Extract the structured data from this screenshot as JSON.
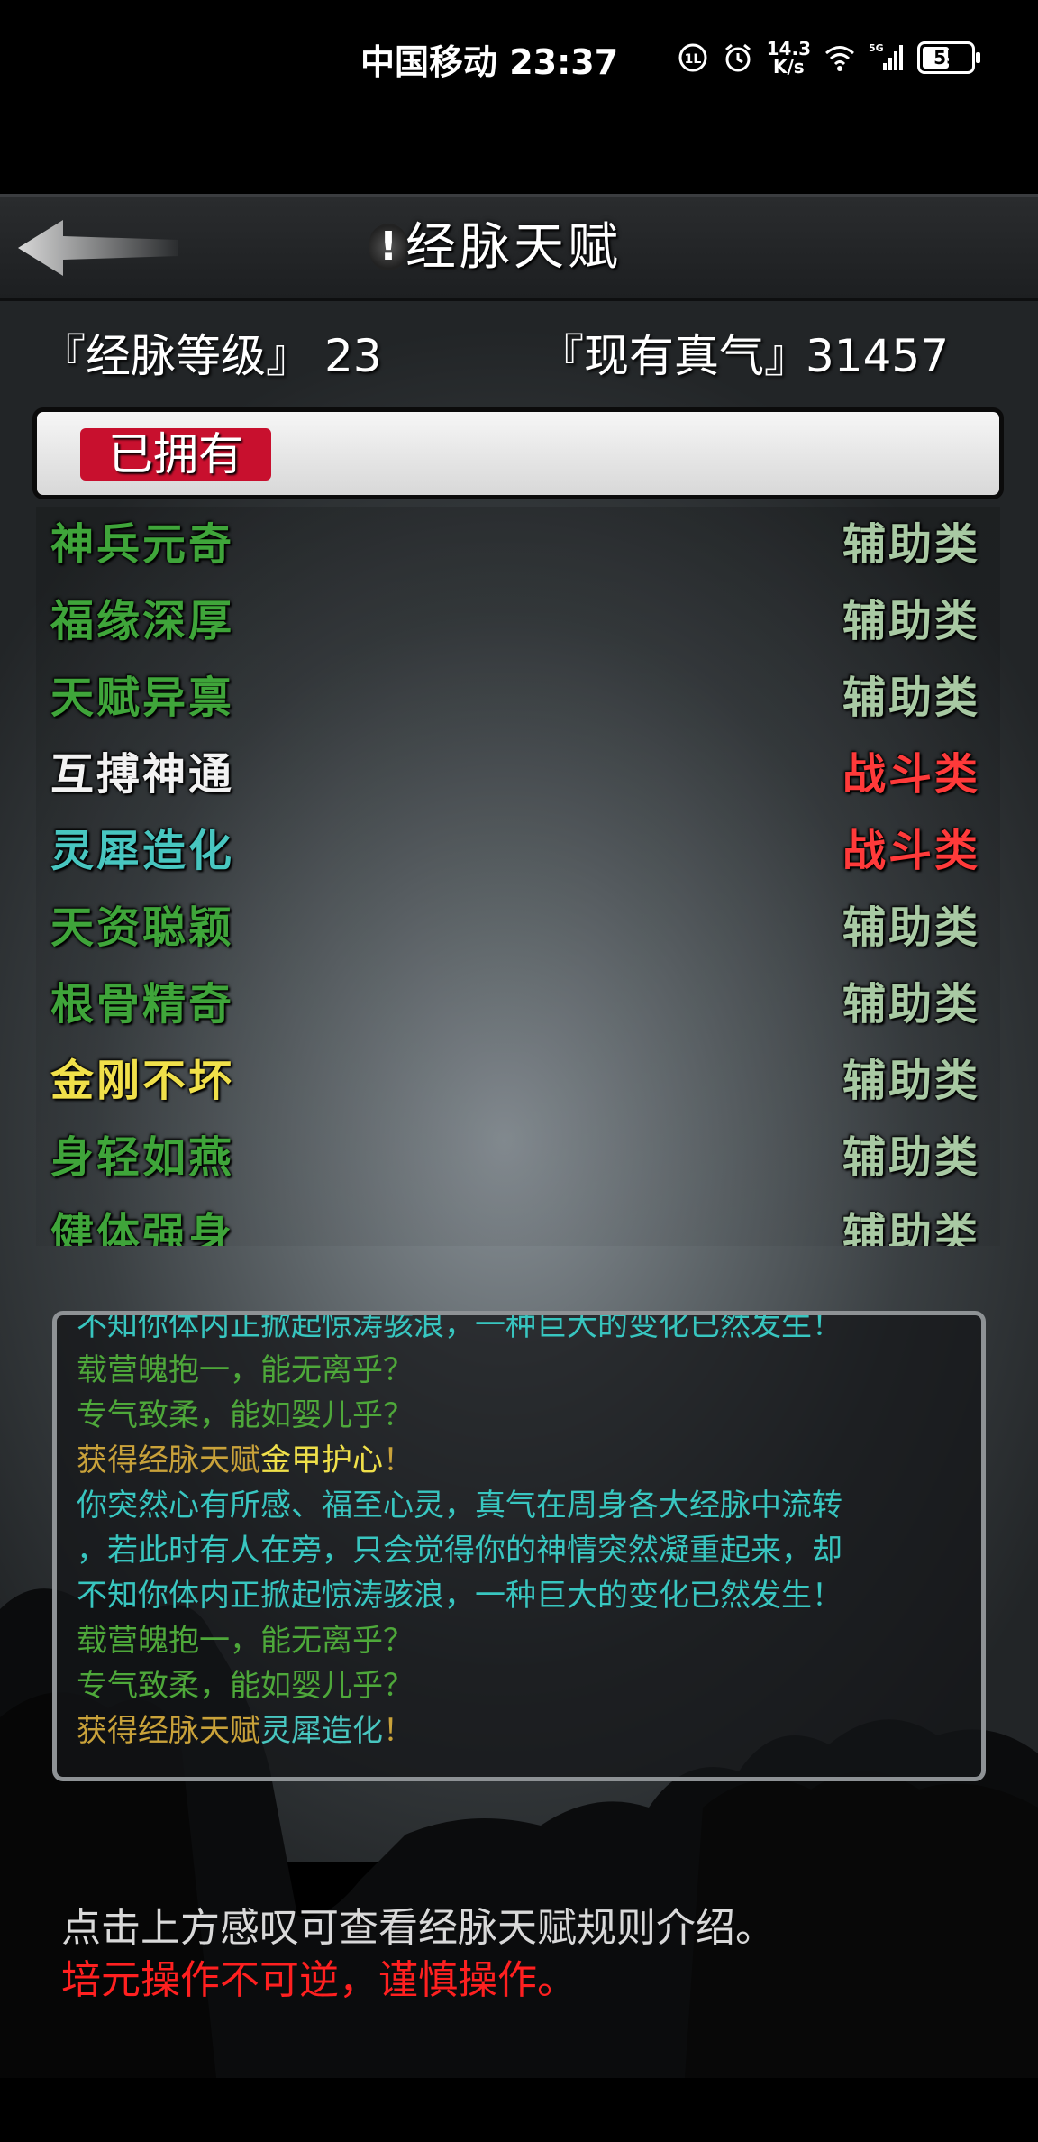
{
  "status_bar": {
    "carrier_time": "中国移动 23:37",
    "net_speed_top": "14.3",
    "net_speed_unit": "K/s",
    "net_type": "5G",
    "battery": "55"
  },
  "header": {
    "help_glyph": "!",
    "title": "经脉天赋"
  },
  "stats": {
    "level_label": "『经脉等级』",
    "level_value": "23",
    "qi_label": "『现有真气』",
    "qi_value": "31457"
  },
  "owned_tab": {
    "label": "已拥有"
  },
  "talents": [
    {
      "name": "神兵元奇",
      "type": "辅助类",
      "name_color": "#3fa53a",
      "type_color": "#a8c9a3"
    },
    {
      "name": "福缘深厚",
      "type": "辅助类",
      "name_color": "#3fa53a",
      "type_color": "#a8c9a3"
    },
    {
      "name": "天赋异禀",
      "type": "辅助类",
      "name_color": "#3fa53a",
      "type_color": "#a8c9a3"
    },
    {
      "name": "互搏神通",
      "type": "战斗类",
      "name_color": "#f2f2f2",
      "type_color": "#ff3a3a"
    },
    {
      "name": "灵犀造化",
      "type": "战斗类",
      "name_color": "#48c6c0",
      "type_color": "#ff3a3a"
    },
    {
      "name": "天资聪颖",
      "type": "辅助类",
      "name_color": "#3fa53a",
      "type_color": "#a8c9a3"
    },
    {
      "name": "根骨精奇",
      "type": "辅助类",
      "name_color": "#3fa53a",
      "type_color": "#a8c9a3"
    },
    {
      "name": "金刚不坏",
      "type": "辅助类",
      "name_color": "#f0e04a",
      "type_color": "#a8c9a3"
    },
    {
      "name": "身轻如燕",
      "type": "辅助类",
      "name_color": "#3fa53a",
      "type_color": "#a8c9a3"
    },
    {
      "name": "健体强身",
      "type": "辅助类",
      "name_color": "#3fa53a",
      "type_color": "#a8c9a3"
    }
  ],
  "log": {
    "lines": [
      {
        "segments": [
          {
            "text": "不知你体内正掀起惊涛骇浪，一种巨大的变化已然发生！",
            "color": "#38c6c0"
          }
        ]
      },
      {
        "segments": [
          {
            "text": "载营魄抱一，能无离乎？",
            "color": "#4ea83a"
          }
        ]
      },
      {
        "segments": [
          {
            "text": "专气致柔，能如婴儿乎？",
            "color": "#4ea83a"
          }
        ]
      },
      {
        "segments": [
          {
            "text": "获得经脉天赋",
            "color": "#c9a23a"
          },
          {
            "text": "金甲护心",
            "color": "#f0e04a"
          },
          {
            "text": "！",
            "color": "#c9a23a"
          }
        ]
      },
      {
        "segments": [
          {
            "text": "你突然心有所感、福至心灵，真气在周身各大经脉中流转",
            "color": "#38c6c0"
          }
        ]
      },
      {
        "segments": [
          {
            "text": "，若此时有人在旁，只会觉得你的神情突然凝重起来，却",
            "color": "#38c6c0"
          }
        ]
      },
      {
        "segments": [
          {
            "text": "不知你体内正掀起惊涛骇浪，一种巨大的变化已然发生！",
            "color": "#38c6c0"
          }
        ]
      },
      {
        "segments": [
          {
            "text": "载营魄抱一，能无离乎？",
            "color": "#4ea83a"
          }
        ]
      },
      {
        "segments": [
          {
            "text": "专气致柔，能如婴儿乎？",
            "color": "#4ea83a"
          }
        ]
      },
      {
        "segments": [
          {
            "text": "获得经脉天赋",
            "color": "#c9a23a"
          },
          {
            "text": "灵犀造化",
            "color": "#48c6c0"
          },
          {
            "text": "！",
            "color": "#c9a23a"
          }
        ]
      }
    ]
  },
  "notes": {
    "hint": "点击上方感叹可查看经脉天赋规则介绍。",
    "warning": "培元操作不可逆，谨慎操作。"
  },
  "colors": {
    "tab_red": "#c8102e",
    "warning_red": "#ff2020"
  }
}
